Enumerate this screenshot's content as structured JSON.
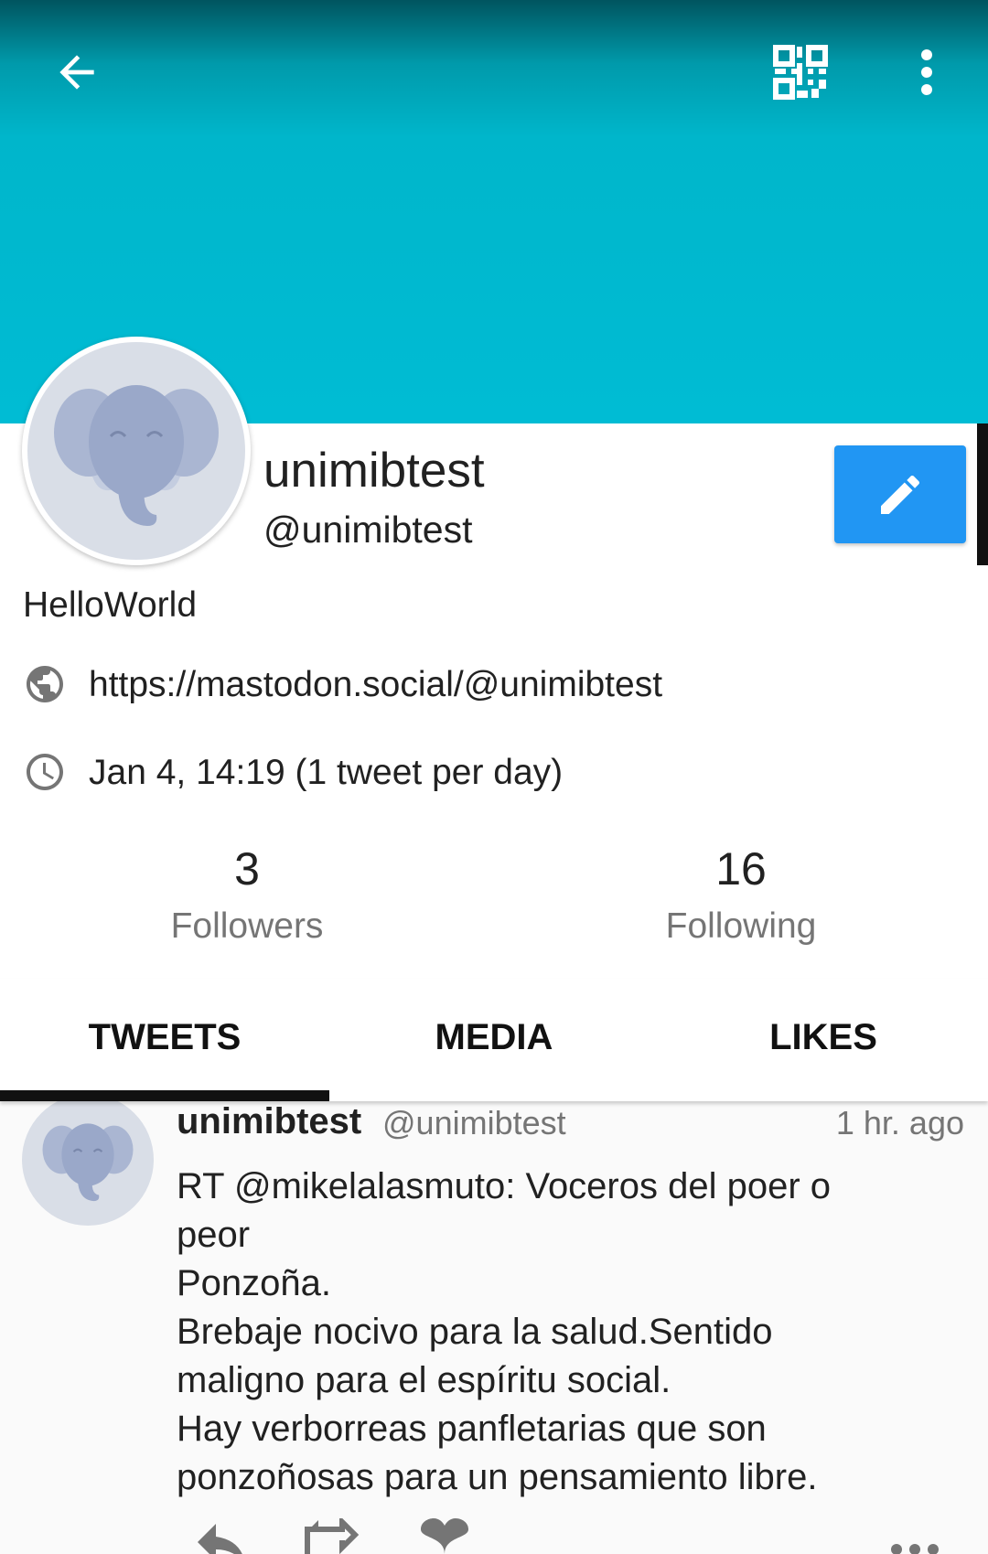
{
  "profile": {
    "display_name": "unimibtest",
    "handle": "@unimibtest",
    "bio": "HelloWorld",
    "url": "https://mastodon.social/@unimibtest",
    "joined": "Jan 4, 14:19 (1 tweet per day)",
    "followers_count": "3",
    "followers_label": "Followers",
    "following_count": "16",
    "following_label": "Following"
  },
  "toolbar": {
    "back_icon": "arrow-back-icon",
    "qr_icon": "qr-code-icon",
    "more_icon": "more-vert-icon",
    "edit_icon": "pencil-icon"
  },
  "tabs": [
    {
      "label": "TWEETS",
      "selected": true
    },
    {
      "label": "MEDIA",
      "selected": false
    },
    {
      "label": "LIKES",
      "selected": false
    }
  ],
  "tweets": [
    {
      "name": "unimibtest",
      "handle": "@unimibtest",
      "time": "1 hr. ago",
      "lines": [
        "RT @mikelalasmuto: Voceros del poer o",
        "peor",
        "Ponzoña.",
        "Brebaje nocivo para la salud.Sentido",
        "maligno para el espíritu social.",
        "Hay verborreas panfletarias que son",
        "ponzoñosas para un pensamiento libre."
      ]
    }
  ],
  "colors": {
    "banner": "#00bcd4",
    "accent": "#2196f3",
    "avatar_bg": "#d9dee7",
    "elephant": "#9aa8c9"
  }
}
